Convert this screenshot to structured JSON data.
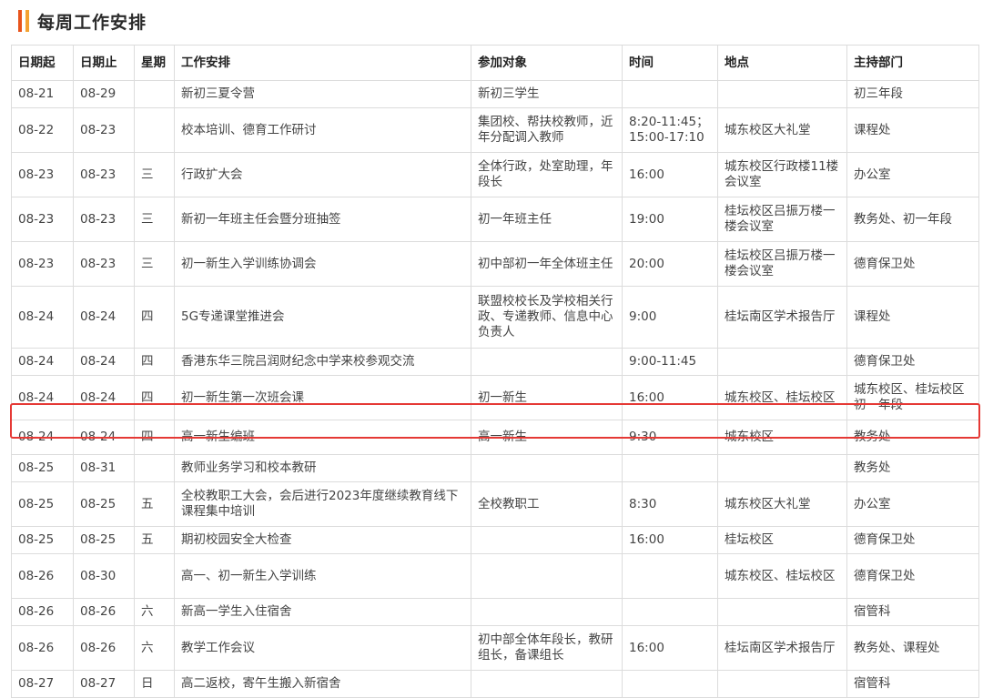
{
  "page": {
    "title": "每周工作安排",
    "accent_colors": [
      "#e8541c",
      "#f4a232"
    ],
    "highlight_color": "#e53935"
  },
  "table": {
    "headers": [
      "日期起",
      "日期止",
      "星期",
      "工作安排",
      "参加对象",
      "时间",
      "地点",
      "主持部门"
    ],
    "rows": [
      [
        "08-21",
        "08-29",
        "",
        "新初三夏令营",
        "新初三学生",
        "",
        "",
        "初三年段"
      ],
      [
        "08-22",
        "08-23",
        "",
        "校本培训、德育工作研讨",
        "集团校、帮扶校教师，近年分配调入教师",
        "8:20-11:45；15:00-17:10",
        "城东校区大礼堂",
        "课程处"
      ],
      [
        "08-23",
        "08-23",
        "三",
        "行政扩大会",
        "全体行政，处室助理，年段长",
        "16:00",
        "城东校区行政楼11楼会议室",
        "办公室"
      ],
      [
        "08-23",
        "08-23",
        "三",
        "新初一年班主任会暨分班抽签",
        "初一年班主任",
        "19:00",
        "桂坛校区吕振万楼一楼会议室",
        "教务处、初一年段"
      ],
      [
        "08-23",
        "08-23",
        "三",
        "初一新生入学训练协调会",
        "初中部初一年全体班主任",
        "20:00",
        "桂坛校区吕振万楼一楼会议室",
        "德育保卫处"
      ],
      [
        "08-24",
        "08-24",
        "四",
        "5G专递课堂推进会",
        "联盟校校长及学校相关行政、专递教师、信息中心负责人",
        "9:00",
        "桂坛南区学术报告厅",
        "课程处"
      ],
      [
        "08-24",
        "08-24",
        "四",
        "香港东华三院吕润财纪念中学来校参观交流",
        "",
        "9:00-11:45",
        "",
        "德育保卫处"
      ],
      [
        "08-24",
        "08-24",
        "四",
        "初一新生第一次班会课",
        "初一新生",
        "16:00",
        "城东校区、桂坛校区",
        "城东校区、桂坛校区初一年段"
      ],
      [
        "08-24",
        "08-24",
        "四",
        "高一新生编班",
        "高一新生",
        "9:30",
        "城东校区",
        "教务处"
      ],
      [
        "08-25",
        "08-31",
        "",
        "教师业务学习和校本教研",
        "",
        "",
        "",
        "教务处"
      ],
      [
        "08-25",
        "08-25",
        "五",
        "全校教职工大会，会后进行2023年度继续教育线下课程集中培训",
        "全校教职工",
        "8:30",
        "城东校区大礼堂",
        "办公室"
      ],
      [
        "08-25",
        "08-25",
        "五",
        "期初校园安全大检查",
        "",
        "16:00",
        "桂坛校区",
        "德育保卫处"
      ],
      [
        "08-26",
        "08-30",
        "",
        "高一、初一新生入学训练",
        "",
        "",
        "城东校区、桂坛校区",
        "德育保卫处"
      ],
      [
        "08-26",
        "08-26",
        "六",
        "新高一学生入住宿舍",
        "",
        "",
        "",
        "宿管科"
      ],
      [
        "08-26",
        "08-26",
        "六",
        "教学工作会议",
        "初中部全体年段长，教研组长，备课组长",
        "16:00",
        "桂坛南区学术报告厅",
        "教务处、课程处"
      ],
      [
        "08-27",
        "08-27",
        "日",
        "高二返校，寄午生搬入新宿舍",
        "",
        "",
        "",
        "宿管科"
      ]
    ]
  }
}
